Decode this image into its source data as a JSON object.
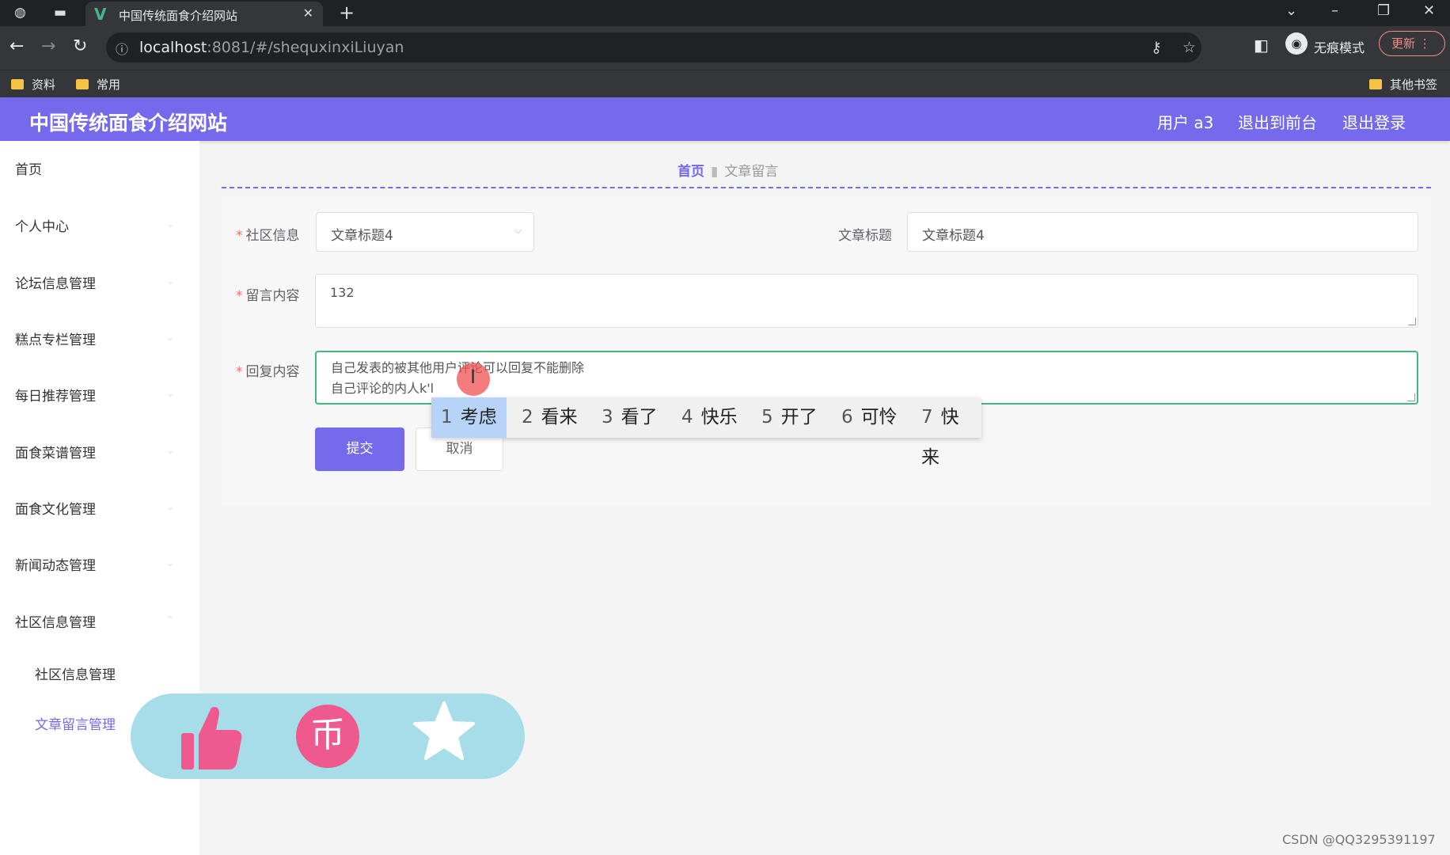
{
  "browser": {
    "tab_title": "中国传统面食介绍网站",
    "tab_logo": "V",
    "url_host": "localhost",
    "url_path": ":8081/#/shequxinxiLiuyan",
    "incognito_label": "无痕模式",
    "update_label": "更新",
    "bookmarks": [
      "资料",
      "常用"
    ],
    "other_bookmarks": "其他书签"
  },
  "header": {
    "site_title": "中国传统面食介绍网站",
    "user": "用户 a3",
    "back_to_front": "退出到前台",
    "logout": "退出登录"
  },
  "sidebar": {
    "items": [
      "首页",
      "个人中心",
      "论坛信息管理",
      "糕点专栏管理",
      "每日推荐管理",
      "面食菜谱管理",
      "面食文化管理",
      "新闻动态管理",
      "社区信息管理"
    ],
    "sub_items": [
      "社区信息管理",
      "文章留言管理"
    ],
    "active_sub": "文章留言管理"
  },
  "breadcrumb": {
    "home": "首页",
    "current": "文章留言"
  },
  "form": {
    "community_label": "社区信息",
    "community_value": "文章标题4",
    "article_title_label": "文章标题",
    "article_title_value": "文章标题4",
    "message_label": "留言内容",
    "message_value": "132",
    "reply_label": "回复内容",
    "reply_line1": "自己发表的被其他用户评论可以回复不能删除",
    "reply_line2": "自己评论的内人k'l",
    "submit": "提交",
    "cancel": "取消"
  },
  "ime": {
    "candidates": [
      {
        "num": "1",
        "text": "考虑"
      },
      {
        "num": "2",
        "text": "看来"
      },
      {
        "num": "3",
        "text": "看了"
      },
      {
        "num": "4",
        "text": "快乐"
      },
      {
        "num": "5",
        "text": "开了"
      },
      {
        "num": "6",
        "text": "可怜"
      },
      {
        "num": "7",
        "text": "快来"
      }
    ],
    "selected_index": 0
  },
  "floating_actions": {
    "coin_glyph": "币",
    "icons": [
      "thumbs-up-icon",
      "coin-icon",
      "star-icon"
    ]
  },
  "watermark": "CSDN @QQ3295391197",
  "colors": {
    "brand": "#7569ec",
    "focus_border": "#42b883",
    "fab_bg": "#a7dce9",
    "fab_icon": "#ee5a8d"
  }
}
